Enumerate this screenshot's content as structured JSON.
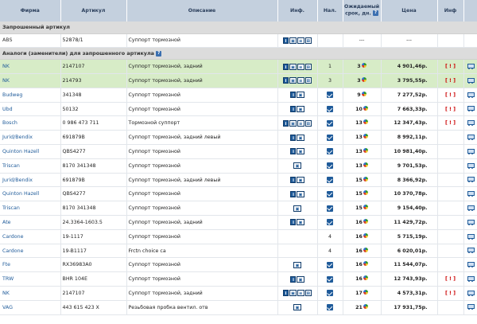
{
  "header": {
    "firm": "Фирма",
    "article": "Артикул",
    "description": "Описание",
    "info": "Инф.",
    "availability": "Нал.",
    "delivery": "Ожидаемый срок, дн.",
    "delivery_help": "?",
    "price": "Цена",
    "info2": "Инф"
  },
  "requested_section": {
    "title": "Запрошенный артикул"
  },
  "requested_row": {
    "firm": "ABS",
    "article": "52878/1",
    "description": "Суппорт тормозной",
    "delivery": "---",
    "price": "---"
  },
  "analogs_section": {
    "title": "Аналоги (заменители) для запрошенного артикула",
    "help": "?"
  },
  "rows": [
    {
      "firm": "NK",
      "article": "2147107",
      "description": "Суппорт тормозной, задний",
      "icons": [
        "info",
        "img",
        "doc",
        "d"
      ],
      "qty": "1",
      "days": "3",
      "price": "4 901,46р.",
      "warn": "[ ! ]",
      "highlight": true
    },
    {
      "firm": "NK",
      "article": "214793",
      "description": "Суппорт тормозной, задний",
      "icons": [
        "info",
        "img",
        "doc",
        "d"
      ],
      "qty": "3",
      "days": "3",
      "price": "3 795,55р.",
      "warn": "[ ! ]",
      "highlight": true
    },
    {
      "firm": "Budweg",
      "article": "341348",
      "description": "Суппорт тормозной",
      "icons": [
        "info",
        "img"
      ],
      "qty": "",
      "days": "9",
      "price": "7 277,52р.",
      "warn": "[ ! ]",
      "highlight": false
    },
    {
      "firm": "Ubd",
      "article": "50132",
      "description": "Суппорт тормозной",
      "icons": [
        "info",
        "img"
      ],
      "qty": "",
      "days": "10",
      "price": "7 663,33р.",
      "warn": "[ ! ]",
      "highlight": false
    },
    {
      "firm": "Bosch",
      "article": "0 986 473 711",
      "description": "Тормозной суппорт",
      "icons": [
        "info",
        "img",
        "doc",
        "d"
      ],
      "qty": "",
      "days": "13",
      "price": "12 347,43р.",
      "warn": "[ ! ]",
      "highlight": false
    },
    {
      "firm": "Jurid/Bendix",
      "article": "691879B",
      "description": "Суппорт тормозной, задний левый",
      "icons": [
        "info",
        "img"
      ],
      "qty": "",
      "days": "13",
      "price": "8 992,11р.",
      "warn": "",
      "highlight": false
    },
    {
      "firm": "Quinton Hazell",
      "article": "QBS4277",
      "description": "Суппорт тормозной",
      "icons": [
        "info",
        "img"
      ],
      "qty": "",
      "days": "13",
      "price": "10 981,40р.",
      "warn": "",
      "highlight": false
    },
    {
      "firm": "Triscan",
      "article": "8170 341348",
      "description": "Суппорт тормозной",
      "icons": [
        "img"
      ],
      "qty": "",
      "days": "13",
      "price": "9 701,53р.",
      "warn": "",
      "highlight": false
    },
    {
      "firm": "Jurid/Bendix",
      "article": "691879B",
      "description": "Суппорт тормозной, задний левый",
      "icons": [
        "info",
        "img"
      ],
      "qty": "",
      "days": "15",
      "price": "8 366,92р.",
      "warn": "",
      "highlight": false
    },
    {
      "firm": "Quinton Hazell",
      "article": "QBS4277",
      "description": "Суппорт тормозной",
      "icons": [
        "info",
        "img"
      ],
      "qty": "",
      "days": "15",
      "price": "10 370,78р.",
      "warn": "",
      "highlight": false
    },
    {
      "firm": "Triscan",
      "article": "8170 341348",
      "description": "Суппорт тормозной",
      "icons": [
        "img"
      ],
      "qty": "",
      "days": "15",
      "price": "9 154,40р.",
      "warn": "",
      "highlight": false
    },
    {
      "firm": "Ate",
      "article": "24.3364-1603.5",
      "description": "Суппорт тормозной, задний",
      "icons": [
        "info",
        "img"
      ],
      "qty": "",
      "days": "16",
      "price": "11 429,72р.",
      "warn": "",
      "highlight": false
    },
    {
      "firm": "Cardone",
      "article": "19-1117",
      "description": "Суппорт тормозной",
      "icons": [],
      "qty": "4",
      "days": "16",
      "price": "5 715,19р.",
      "warn": "",
      "highlight": false
    },
    {
      "firm": "Cardone",
      "article": "19-B1117",
      "description": "Frctn choice ca",
      "icons": [],
      "qty": "4",
      "days": "16",
      "price": "6 020,01р.",
      "warn": "",
      "highlight": false
    },
    {
      "firm": "Fte",
      "article": "RX36983A0",
      "description": "Суппорт тормозной",
      "icons": [
        "img"
      ],
      "qty": "",
      "days": "16",
      "price": "11 544,07р.",
      "warn": "",
      "highlight": false
    },
    {
      "firm": "TRW",
      "article": "BHR 104E",
      "description": "Суппорт тормозной",
      "icons": [
        "info",
        "img"
      ],
      "qty": "",
      "days": "16",
      "price": "12 743,93р.",
      "warn": "[ ! ]",
      "highlight": false
    },
    {
      "firm": "NK",
      "article": "2147107",
      "description": "Суппорт тормозной, задний",
      "icons": [
        "info",
        "img",
        "doc",
        "d"
      ],
      "qty": "",
      "days": "17",
      "price": "4 573,31р.",
      "warn": "[ ! ]",
      "highlight": false
    },
    {
      "firm": "VAG",
      "article": "443 615 423 X",
      "description": "Резьбовая пробка вентил. отв",
      "icons": [
        "img"
      ],
      "qty": "",
      "days": "21",
      "price": "17 931,75р.",
      "warn": "",
      "highlight": false
    }
  ]
}
